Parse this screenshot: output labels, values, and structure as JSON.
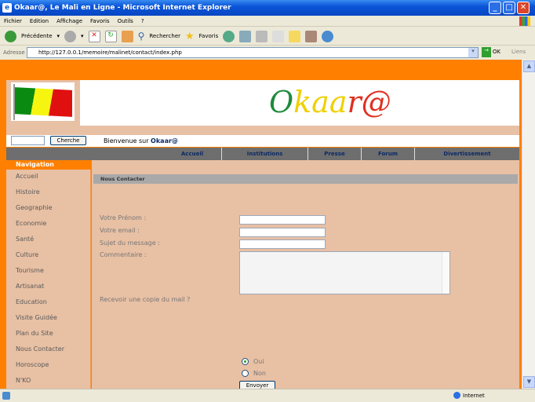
{
  "window": {
    "title": "Okaar@, Le Mali en Ligne - Microsoft Internet Explorer"
  },
  "menu": [
    "Fichier",
    "Edition",
    "Affichage",
    "Favoris",
    "Outils",
    "?"
  ],
  "toolbar": {
    "back": "Précédente",
    "search": "Rechercher",
    "favorites": "Favoris"
  },
  "address": {
    "label": "Adresse",
    "url": "http://127.0.0.1/memoire/malinet/contact/index.php",
    "go": "OK",
    "links": "Liens"
  },
  "site": {
    "logo": "Okaar@",
    "search_button": "Cherche",
    "search_value": "",
    "welcome": "Bienvenue sur ",
    "welcome_brand": "Okaar@",
    "colors": {
      "orange": "#ff8000",
      "peach": "#e8c0a4",
      "green": "#1e8a3c",
      "yellow": "#f0d000",
      "red": "#e03020"
    }
  },
  "topnav": [
    "Accueil",
    "Institutions",
    "Presse",
    "Forum",
    "Divertissement"
  ],
  "sidebar": {
    "title": "Navigation",
    "items": [
      "Accueil",
      "Histoire",
      "Geographie",
      "Economie",
      "Santé",
      "Culture",
      "Tourisme",
      "Artisanat",
      "Education",
      "Visite Guidée",
      "Plan du Site",
      "Nous Contacter",
      "Horoscope",
      "N'KO"
    ]
  },
  "form": {
    "title": "Nous Contacter",
    "prenom": "Votre Prénom :",
    "email": "Votre email :",
    "sujet": "Sujet du message :",
    "commentaire": "Commentaire :",
    "copie": "Recevoir une copie du mail ?",
    "oui": "Oui",
    "non": "Non",
    "submit": "Envoyer"
  },
  "status": {
    "zone": "Internet"
  }
}
